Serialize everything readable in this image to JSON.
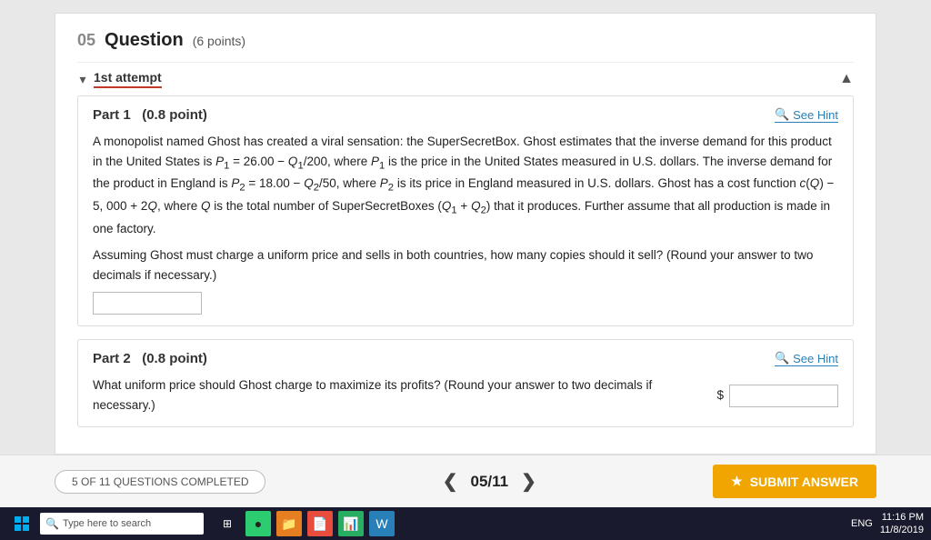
{
  "question": {
    "number": "05",
    "title": "Question",
    "points_label": "(6 points)"
  },
  "attempt": {
    "label": "1st attempt",
    "nav_up_symbol": "▲"
  },
  "part1": {
    "title": "Part 1",
    "points": "(0.8 point)",
    "hint_label": "See Hint",
    "body_text": "A monopolist named Ghost has created a viral sensation: the SuperSecretBox. Ghost estimates that the inverse demand for this product in the United States is P₁ = 26.00 − Q₁/200, where P₁ is the price in the United States measured in U.S. dollars. The inverse demand for the product in England is P₂ = 18.00 − Q₂/50, where P₂ is its price in England measured in U.S. dollars. Ghost has a cost function c(Q) − 5,000 + 2Q, where Q is the total number of SuperSecretBoxes (Q₁ + Q₂) that it produces. Further assume that all production is made in one factory.",
    "question_text": "Assuming Ghost must charge a uniform price and sells in both countries, how many copies should it sell? (Round your answer to two decimals if necessary.)",
    "input_placeholder": ""
  },
  "part2": {
    "title": "Part 2",
    "points": "(0.8 point)",
    "hint_label": "See Hint",
    "question_text": "What uniform price should Ghost charge to maximize its profits? (Round your answer to two decimals if necessary.)",
    "dollar_symbol": "$",
    "input_placeholder": ""
  },
  "bottom_bar": {
    "progress_label": "5 OF 11 QUESTIONS COMPLETED",
    "nav_prev": "❮",
    "nav_page": "05",
    "nav_slash": "/",
    "nav_total": "11",
    "nav_next": "❯",
    "submit_label": "SUBMIT ANSWER",
    "submit_star": "★"
  },
  "taskbar": {
    "search_placeholder": "Type here to search",
    "time": "11:16 PM",
    "date": "11/8/2019",
    "lang": "ENG"
  }
}
